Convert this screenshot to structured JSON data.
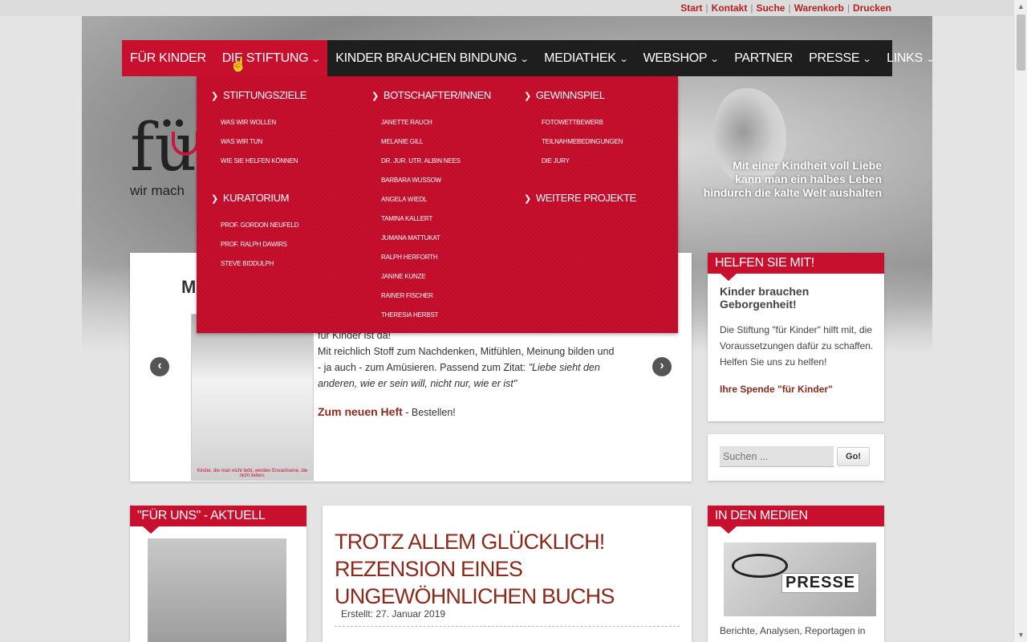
{
  "toplinks": [
    "Start",
    "Kontakt",
    "Suche",
    "Warenkorb",
    "Drucken"
  ],
  "header": {
    "logo_letters": "fü",
    "logo_tagline": "wir mach",
    "quote_lines": [
      "Mit einer Kindheit voll Liebe",
      "kann man ein halbes Leben",
      "hindurch die kalte Welt aushalten"
    ]
  },
  "nav": {
    "items": [
      {
        "label": "FÜR KINDER",
        "chevron": false
      },
      {
        "label": "DIE STIFTUNG",
        "chevron": true
      },
      {
        "label": "KINDER BRAUCHEN BINDUNG",
        "chevron": true
      },
      {
        "label": "MEDIATHEK",
        "chevron": true
      },
      {
        "label": "WEBSHOP",
        "chevron": true
      },
      {
        "label": "PARTNER",
        "chevron": false
      },
      {
        "label": "PRESSE",
        "chevron": true
      },
      {
        "label": "LINKS",
        "chevron": true
      }
    ],
    "flag_icon": "uk-flag-icon",
    "accent_color": "#c8102e"
  },
  "dropdown": {
    "col1": {
      "head1": "STIFTUNGSZIELE",
      "links1": [
        "WAS WIR WOLLEN",
        "WAS WIR TUN",
        "WIE SIE HELFEN KÖNNEN"
      ],
      "head2": "KURATORIUM",
      "links2": [
        "PROF. GORDON NEUFELD",
        "PROF. RALPH DAWIRS",
        "STEVE BIDDULPH"
      ]
    },
    "col2": {
      "head1": "BOTSCHAFTER/INNEN",
      "links1": [
        "JANETTE RAUCH",
        "MELANIE GILL",
        "DR. JUR. UTR. ALBIN NEES",
        "BARBARA WUSSOW",
        "ANGELA WIEDL",
        "TAMINA KALLERT",
        "JUMANA MATTUKAT",
        "RALPH HERFORTH",
        "JANINE KUNZE",
        "RAINER FISCHER",
        "THERESIA HERBST"
      ]
    },
    "col3": {
      "head1": "GEWINNSPIEL",
      "links1": [
        "FOTOWETTBEWERB",
        "TEILNAHMEBEDINGUNGEN",
        "DIE JURY"
      ],
      "head2": "WEITERE PROJEKTE"
    }
  },
  "slider": {
    "title_visible": "M",
    "text_partial": "für Kinder ist da!",
    "text": "Mit reichlich Stoff zum Nachdenken, Mitfühlen, Meinung bilden und - ja auch - zum Amüsieren. Passend zum Zitat: ",
    "quote": "\"Liebe sieht den anderen, wie er sein will, nicht nur, wie er ist\"",
    "cta_link": "Zum neuen Heft",
    "cta_rest": " - Bestellen!",
    "image_caption": "Kinder, die man nicht liebt, werden Erwachsene, die nicht lieben.",
    "prev": "‹",
    "next": "›"
  },
  "help": {
    "title": "HELFEN SIE MIT!",
    "heading": "Kinder brauchen Geborgenheit!",
    "body": "Die Stiftung \"für Kinder\" hilft mit, die Voraussetzungen dafür zu schaffen. Helfen Sie uns zu helfen!",
    "link": "Ihre Spende \"für Kinder\""
  },
  "search": {
    "placeholder": "Suchen ...",
    "button": "Go!"
  },
  "aktuell": {
    "title": "\"FÜR UNS\" - AKTUELL"
  },
  "article": {
    "title": "TROTZ ALLEM GLÜCKLICH! REZENSION EINES UNGEWÖHNLICHEN BUCHS",
    "meta": "Erstellt: 27. Januar 2019"
  },
  "medien": {
    "title": "IN DEN MEDIEN",
    "image_label": "PRESSE",
    "text": "Berichte, Analysen, Reportagen in"
  }
}
